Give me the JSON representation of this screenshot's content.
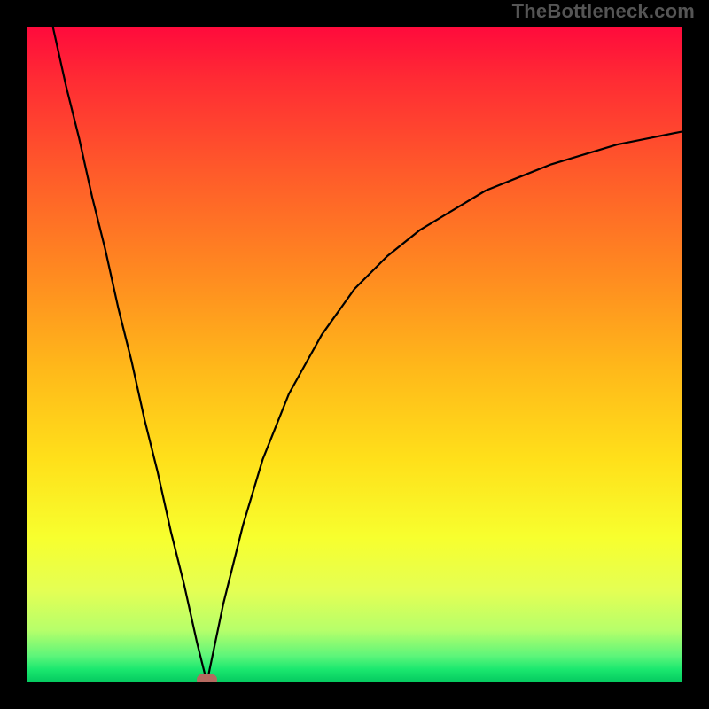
{
  "watermark": "TheBottleneck.com",
  "chart_data": {
    "type": "line",
    "title": "",
    "xlabel": "",
    "ylabel": "",
    "xlim": [
      0,
      100
    ],
    "ylim": [
      0,
      100
    ],
    "grid": false,
    "legend": false,
    "background_gradient": {
      "top_color": "#ff0a3c",
      "bottom_color": "#04c95f",
      "description": "vertical red-to-green gradient (bottleneck severity: top = 100%, bottom = 0%)"
    },
    "series": [
      {
        "name": "left-branch",
        "x": [
          4,
          6,
          8,
          10,
          12,
          14,
          16,
          18,
          20,
          22,
          24,
          26,
          27.5
        ],
        "y": [
          100,
          91,
          83,
          74,
          66,
          57,
          49,
          40,
          32,
          23,
          15,
          6,
          0
        ]
      },
      {
        "name": "right-branch",
        "x": [
          27.5,
          30,
          33,
          36,
          40,
          45,
          50,
          55,
          60,
          65,
          70,
          75,
          80,
          85,
          90,
          95,
          100
        ],
        "y": [
          0,
          12,
          24,
          34,
          44,
          53,
          60,
          65,
          69,
          72,
          75,
          77,
          79,
          80.5,
          82,
          83,
          84
        ]
      }
    ],
    "marker": {
      "x": 27.5,
      "y": 0,
      "shape": "round-rect",
      "color": "#b56a60"
    },
    "annotations": []
  }
}
